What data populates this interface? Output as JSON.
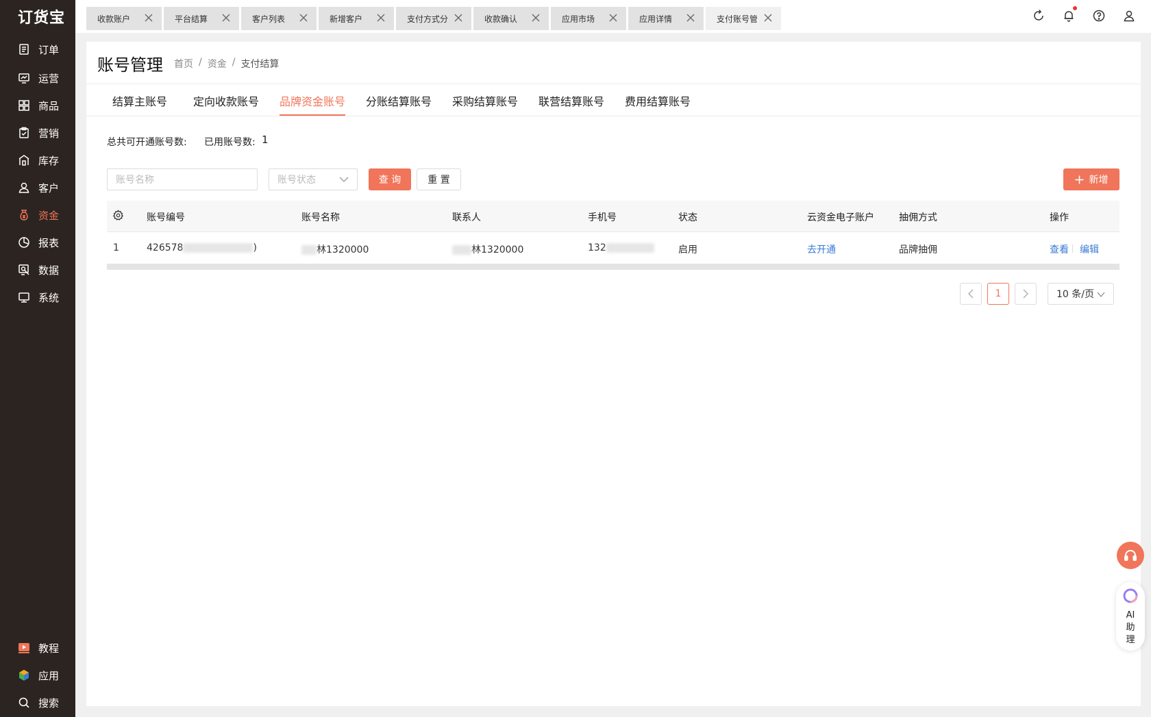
{
  "brand": {
    "logo_text": "订货宝"
  },
  "sidebar": {
    "items": [
      {
        "label": "订单",
        "icon": "order-icon"
      },
      {
        "label": "运营",
        "icon": "operation-icon"
      },
      {
        "label": "商品",
        "icon": "goods-icon"
      },
      {
        "label": "营销",
        "icon": "marketing-icon"
      },
      {
        "label": "库存",
        "icon": "inventory-icon"
      },
      {
        "label": "客户",
        "icon": "customer-icon"
      },
      {
        "label": "资金",
        "icon": "funds-icon",
        "active": true
      },
      {
        "label": "报表",
        "icon": "report-icon"
      },
      {
        "label": "数据",
        "icon": "data-icon"
      },
      {
        "label": "系统",
        "icon": "system-icon"
      }
    ],
    "bottom_items": [
      {
        "label": "教程",
        "icon": "tutorial-icon"
      },
      {
        "label": "应用",
        "icon": "apps-icon"
      },
      {
        "label": "搜索",
        "icon": "search-icon"
      }
    ]
  },
  "window_tabs": [
    {
      "label": "收款账户"
    },
    {
      "label": "平台结算"
    },
    {
      "label": "客户列表"
    },
    {
      "label": "新增客户"
    },
    {
      "label": "支付方式分"
    },
    {
      "label": "收款确认"
    },
    {
      "label": "应用市场"
    },
    {
      "label": "应用详情"
    },
    {
      "label": "支付账号管",
      "active": true
    }
  ],
  "top_icons": [
    "refresh-icon",
    "bell-icon",
    "help-icon",
    "user-icon"
  ],
  "page": {
    "title": "账号管理",
    "breadcrumb": [
      "首页",
      "资金",
      "支付结算"
    ],
    "breadcrumb_sep": "/"
  },
  "subtabs": [
    {
      "label": "结算主账号"
    },
    {
      "label": "定向收款账号"
    },
    {
      "label": "品牌资金账号",
      "active": true
    },
    {
      "label": "分账结算账号"
    },
    {
      "label": "采购结算账号"
    },
    {
      "label": "联营结算账号"
    },
    {
      "label": "费用结算账号"
    }
  ],
  "counts": {
    "total_label": "总共可开通账号数:",
    "used_label": "已用账号数:",
    "used_value": "1"
  },
  "filters": {
    "name_placeholder": "账号名称",
    "status_placeholder": "账号状态",
    "query_label": "查 询",
    "reset_label": "重 置",
    "add_label": "新增"
  },
  "table": {
    "columns": [
      "账号编号",
      "账号名称",
      "联系人",
      "手机号",
      "状态",
      "云资金电子账户",
      "抽佣方式",
      "操作"
    ],
    "rows": [
      {
        "index": "1",
        "account_no_prefix": "426578",
        "account_no_suffix": ")",
        "account_name_suffix": "林1320000",
        "contact_suffix": "林1320000",
        "phone_prefix": "132",
        "status": "启用",
        "cloud_account": "去开通",
        "commission": "品牌抽佣",
        "action_view": "查看",
        "action_edit": "编辑"
      }
    ]
  },
  "pagination": {
    "current_page": "1",
    "page_size": "10 条/页"
  },
  "floating": {
    "ai_label": [
      "AI",
      "助",
      "理"
    ]
  },
  "colors": {
    "accent": "#f0755a",
    "sidebar_bg": "#2c2420",
    "link": "#3a7bd5"
  }
}
